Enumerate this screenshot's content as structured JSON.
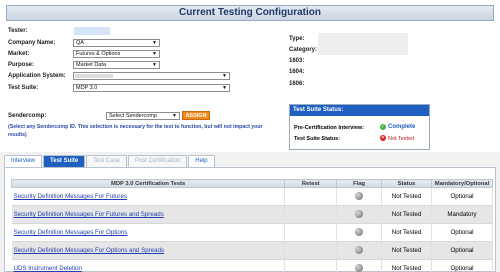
{
  "page": {
    "title": "Current Testing Configuration"
  },
  "form": {
    "tester_label": "Tester:",
    "company_label": "Company Name:",
    "company_value": "QA",
    "market_label": "Market:",
    "market_value": "Futures & Options",
    "purpose_label": "Purpose:",
    "purpose_value": "Market Data",
    "app_system_label": "Application System:",
    "test_suite_label": "Test Suite:",
    "test_suite_value": "MDP 3.0",
    "sendercomp_label": "Sendercomp:",
    "sendercomp_placeholder": "Select Sendercomp",
    "assign_label": "ASSIGN",
    "note": "(Select any Sendercomp ID. This selection is necessary for the test to function, but will not impact your results)"
  },
  "info": {
    "type_label": "Type:",
    "category_label": "Category:",
    "f1603_label": "1603:",
    "f1604_label": "1604:",
    "f1606_label": "1606:"
  },
  "status_panel": {
    "heading": "Test Suite Status:",
    "precert_label": "Pre-Certification Interview:",
    "precert_value": "Complete",
    "suite_status_label": "Test Suite Status:",
    "suite_status_value": "Not Tested"
  },
  "tabs": [
    "Interview",
    "Test Suite",
    "Test Case",
    "Post Certification",
    "Help"
  ],
  "table": {
    "headers": [
      "MDP 3.0 Certification Tests",
      "Retest",
      "Flag",
      "Status",
      "Mandatory/Optional"
    ],
    "rows": [
      {
        "name": "Security Definition Messages For Futures",
        "status": "Not Tested",
        "mandatory": "Optional"
      },
      {
        "name": "Security Definition Messages For Futures and Spreads",
        "status": "Not Tested",
        "mandatory": "Mandatory"
      },
      {
        "name": "Security Definition Messages For Options",
        "status": "Not Tested",
        "mandatory": "Optional"
      },
      {
        "name": "Security Definition Messages For Options and Spreads",
        "status": "Not Tested",
        "mandatory": "Optional"
      },
      {
        "name": "UDS Instrument Deletion",
        "status": "Not Tested",
        "mandatory": "Optional"
      }
    ]
  }
}
